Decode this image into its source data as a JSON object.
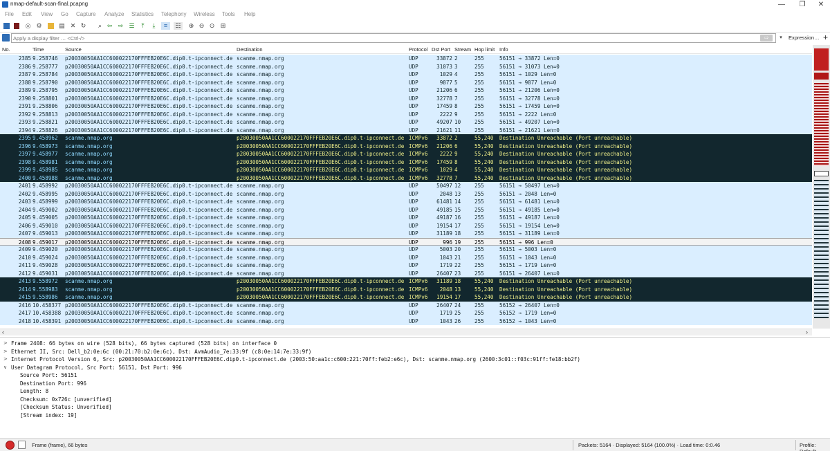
{
  "window": {
    "title": "nmap-default-scan-final.pcapng",
    "minimize": "—",
    "restore": "❐",
    "close": "✕"
  },
  "menu": [
    "File",
    "Edit",
    "View",
    "Go",
    "Capture",
    "Analyze",
    "Statistics",
    "Telephony",
    "Wireless",
    "Tools",
    "Help"
  ],
  "filter": {
    "placeholder": "Apply a display filter … <Ctrl-/>",
    "apply": "⇨",
    "dropdown": "▾",
    "expression": "Expression…",
    "add": "+"
  },
  "columns": [
    "No.",
    "Time",
    "Source",
    "Destination",
    "Protocol",
    "Dst Port",
    "Stream",
    "Hop limit",
    "Info"
  ],
  "packets": [
    {
      "no": "2385",
      "time": "9.258746",
      "src": "p20030050AA1CC600022170FFFEB20E6C.dip0.t-ipconnect.de",
      "dst": "scanme.nmap.org",
      "proto": "UDP",
      "port": "33872",
      "stream": "2",
      "hop": "255",
      "info": "56151 → 33872 Len=0",
      "kind": "udp"
    },
    {
      "no": "2386",
      "time": "9.258777",
      "src": "p20030050AA1CC600022170FFFEB20E6C.dip0.t-ipconnect.de",
      "dst": "scanme.nmap.org",
      "proto": "UDP",
      "port": "31073",
      "stream": "3",
      "hop": "255",
      "info": "56151 → 31073 Len=0",
      "kind": "udp"
    },
    {
      "no": "2387",
      "time": "9.258784",
      "src": "p20030050AA1CC600022170FFFEB20E6C.dip0.t-ipconnect.de",
      "dst": "scanme.nmap.org",
      "proto": "UDP",
      "port": "1029",
      "stream": "4",
      "hop": "255",
      "info": "56151 → 1029 Len=0",
      "kind": "udp"
    },
    {
      "no": "2388",
      "time": "9.258790",
      "src": "p20030050AA1CC600022170FFFEB20E6C.dip0.t-ipconnect.de",
      "dst": "scanme.nmap.org",
      "proto": "UDP",
      "port": "9877",
      "stream": "5",
      "hop": "255",
      "info": "56151 → 9877 Len=0",
      "kind": "udp"
    },
    {
      "no": "2389",
      "time": "9.258795",
      "src": "p20030050AA1CC600022170FFFEB20E6C.dip0.t-ipconnect.de",
      "dst": "scanme.nmap.org",
      "proto": "UDP",
      "port": "21206",
      "stream": "6",
      "hop": "255",
      "info": "56151 → 21206 Len=0",
      "kind": "udp"
    },
    {
      "no": "2390",
      "time": "9.258801",
      "src": "p20030050AA1CC600022170FFFEB20E6C.dip0.t-ipconnect.de",
      "dst": "scanme.nmap.org",
      "proto": "UDP",
      "port": "32778",
      "stream": "7",
      "hop": "255",
      "info": "56151 → 32778 Len=0",
      "kind": "udp"
    },
    {
      "no": "2391",
      "time": "9.258806",
      "src": "p20030050AA1CC600022170FFFEB20E6C.dip0.t-ipconnect.de",
      "dst": "scanme.nmap.org",
      "proto": "UDP",
      "port": "17459",
      "stream": "8",
      "hop": "255",
      "info": "56151 → 17459 Len=0",
      "kind": "udp"
    },
    {
      "no": "2392",
      "time": "9.258813",
      "src": "p20030050AA1CC600022170FFFEB20E6C.dip0.t-ipconnect.de",
      "dst": "scanme.nmap.org",
      "proto": "UDP",
      "port": "2222",
      "stream": "9",
      "hop": "255",
      "info": "56151 → 2222 Len=0",
      "kind": "udp"
    },
    {
      "no": "2393",
      "time": "9.258821",
      "src": "p20030050AA1CC600022170FFFEB20E6C.dip0.t-ipconnect.de",
      "dst": "scanme.nmap.org",
      "proto": "UDP",
      "port": "49207",
      "stream": "10",
      "hop": "255",
      "info": "56151 → 49207 Len=0",
      "kind": "udp"
    },
    {
      "no": "2394",
      "time": "9.258826",
      "src": "p20030050AA1CC600022170FFFEB20E6C.dip0.t-ipconnect.de",
      "dst": "scanme.nmap.org",
      "proto": "UDP",
      "port": "21621",
      "stream": "11",
      "hop": "255",
      "info": "56151 → 21621 Len=0",
      "kind": "udp"
    },
    {
      "no": "2395",
      "time": "9.458962",
      "src": "scanme.nmap.org",
      "dst": "p20030050AA1CC600022170FFFEB20E6C.dip0.t-ipconnect.de",
      "proto": "ICMPv6",
      "port": "33872",
      "stream": "2",
      "hop": "55,240",
      "info": "Destination Unreachable (Port unreachable)",
      "kind": "icmp"
    },
    {
      "no": "2396",
      "time": "9.458973",
      "src": "scanme.nmap.org",
      "dst": "p20030050AA1CC600022170FFFEB20E6C.dip0.t-ipconnect.de",
      "proto": "ICMPv6",
      "port": "21206",
      "stream": "6",
      "hop": "55,240",
      "info": "Destination Unreachable (Port unreachable)",
      "kind": "icmp"
    },
    {
      "no": "2397",
      "time": "9.458977",
      "src": "scanme.nmap.org",
      "dst": "p20030050AA1CC600022170FFFEB20E6C.dip0.t-ipconnect.de",
      "proto": "ICMPv6",
      "port": "2222",
      "stream": "9",
      "hop": "55,240",
      "info": "Destination Unreachable (Port unreachable)",
      "kind": "icmp"
    },
    {
      "no": "2398",
      "time": "9.458981",
      "src": "scanme.nmap.org",
      "dst": "p20030050AA1CC600022170FFFEB20E6C.dip0.t-ipconnect.de",
      "proto": "ICMPv6",
      "port": "17459",
      "stream": "8",
      "hop": "55,240",
      "info": "Destination Unreachable (Port unreachable)",
      "kind": "icmp"
    },
    {
      "no": "2399",
      "time": "9.458985",
      "src": "scanme.nmap.org",
      "dst": "p20030050AA1CC600022170FFFEB20E6C.dip0.t-ipconnect.de",
      "proto": "ICMPv6",
      "port": "1029",
      "stream": "4",
      "hop": "55,240",
      "info": "Destination Unreachable (Port unreachable)",
      "kind": "icmp"
    },
    {
      "no": "2400",
      "time": "9.458988",
      "src": "scanme.nmap.org",
      "dst": "p20030050AA1CC600022170FFFEB20E6C.dip0.t-ipconnect.de",
      "proto": "ICMPv6",
      "port": "32778",
      "stream": "7",
      "hop": "55,240",
      "info": "Destination Unreachable (Port unreachable)",
      "kind": "icmp"
    },
    {
      "no": "2401",
      "time": "9.458992",
      "src": "p20030050AA1CC600022170FFFEB20E6C.dip0.t-ipconnect.de",
      "dst": "scanme.nmap.org",
      "proto": "UDP",
      "port": "50497",
      "stream": "12",
      "hop": "255",
      "info": "56151 → 50497 Len=0",
      "kind": "udp"
    },
    {
      "no": "2402",
      "time": "9.458995",
      "src": "p20030050AA1CC600022170FFFEB20E6C.dip0.t-ipconnect.de",
      "dst": "scanme.nmap.org",
      "proto": "UDP",
      "port": "2048",
      "stream": "13",
      "hop": "255",
      "info": "56151 → 2048 Len=0",
      "kind": "udp"
    },
    {
      "no": "2403",
      "time": "9.458999",
      "src": "p20030050AA1CC600022170FFFEB20E6C.dip0.t-ipconnect.de",
      "dst": "scanme.nmap.org",
      "proto": "UDP",
      "port": "61481",
      "stream": "14",
      "hop": "255",
      "info": "56151 → 61481 Len=0",
      "kind": "udp"
    },
    {
      "no": "2404",
      "time": "9.459002",
      "src": "p20030050AA1CC600022170FFFEB20E6C.dip0.t-ipconnect.de",
      "dst": "scanme.nmap.org",
      "proto": "UDP",
      "port": "49185",
      "stream": "15",
      "hop": "255",
      "info": "56151 → 49185 Len=0",
      "kind": "udp"
    },
    {
      "no": "2405",
      "time": "9.459005",
      "src": "p20030050AA1CC600022170FFFEB20E6C.dip0.t-ipconnect.de",
      "dst": "scanme.nmap.org",
      "proto": "UDP",
      "port": "49187",
      "stream": "16",
      "hop": "255",
      "info": "56151 → 49187 Len=0",
      "kind": "udp"
    },
    {
      "no": "2406",
      "time": "9.459010",
      "src": "p20030050AA1CC600022170FFFEB20E6C.dip0.t-ipconnect.de",
      "dst": "scanme.nmap.org",
      "proto": "UDP",
      "port": "19154",
      "stream": "17",
      "hop": "255",
      "info": "56151 → 19154 Len=0",
      "kind": "udp"
    },
    {
      "no": "2407",
      "time": "9.459013",
      "src": "p20030050AA1CC600022170FFFEB20E6C.dip0.t-ipconnect.de",
      "dst": "scanme.nmap.org",
      "proto": "UDP",
      "port": "31189",
      "stream": "18",
      "hop": "255",
      "info": "56151 → 31189 Len=0",
      "kind": "udp"
    },
    {
      "no": "2408",
      "time": "9.459017",
      "src": "p20030050AA1CC600022170FFFEB20E6C.dip0.t-ipconnect.de",
      "dst": "scanme.nmap.org",
      "proto": "UDP",
      "port": "996",
      "stream": "19",
      "hop": "255",
      "info": "56151 → 996 Len=0",
      "kind": "sel"
    },
    {
      "no": "2409",
      "time": "9.459020",
      "src": "p20030050AA1CC600022170FFFEB20E6C.dip0.t-ipconnect.de",
      "dst": "scanme.nmap.org",
      "proto": "UDP",
      "port": "5003",
      "stream": "20",
      "hop": "255",
      "info": "56151 → 5003 Len=0",
      "kind": "udp"
    },
    {
      "no": "2410",
      "time": "9.459024",
      "src": "p20030050AA1CC600022170FFFEB20E6C.dip0.t-ipconnect.de",
      "dst": "scanme.nmap.org",
      "proto": "UDP",
      "port": "1043",
      "stream": "21",
      "hop": "255",
      "info": "56151 → 1043 Len=0",
      "kind": "udp"
    },
    {
      "no": "2411",
      "time": "9.459028",
      "src": "p20030050AA1CC600022170FFFEB20E6C.dip0.t-ipconnect.de",
      "dst": "scanme.nmap.org",
      "proto": "UDP",
      "port": "1719",
      "stream": "22",
      "hop": "255",
      "info": "56151 → 1719 Len=0",
      "kind": "udp"
    },
    {
      "no": "2412",
      "time": "9.459031",
      "src": "p20030050AA1CC600022170FFFEB20E6C.dip0.t-ipconnect.de",
      "dst": "scanme.nmap.org",
      "proto": "UDP",
      "port": "26407",
      "stream": "23",
      "hop": "255",
      "info": "56151 → 26407 Len=0",
      "kind": "udp"
    },
    {
      "no": "2413",
      "time": "9.558972",
      "src": "scanme.nmap.org",
      "dst": "p20030050AA1CC600022170FFFEB20E6C.dip0.t-ipconnect.de",
      "proto": "ICMPv6",
      "port": "31189",
      "stream": "18",
      "hop": "55,240",
      "info": "Destination Unreachable (Port unreachable)",
      "kind": "icmp"
    },
    {
      "no": "2414",
      "time": "9.558983",
      "src": "scanme.nmap.org",
      "dst": "p20030050AA1CC600022170FFFEB20E6C.dip0.t-ipconnect.de",
      "proto": "ICMPv6",
      "port": "2048",
      "stream": "13",
      "hop": "55,240",
      "info": "Destination Unreachable (Port unreachable)",
      "kind": "icmp"
    },
    {
      "no": "2415",
      "time": "9.558986",
      "src": "scanme.nmap.org",
      "dst": "p20030050AA1CC600022170FFFEB20E6C.dip0.t-ipconnect.de",
      "proto": "ICMPv6",
      "port": "19154",
      "stream": "17",
      "hop": "55,240",
      "info": "Destination Unreachable (Port unreachable)",
      "kind": "icmp"
    },
    {
      "no": "2416",
      "time": "10.458377",
      "src": "p20030050AA1CC600022170FFFEB20E6C.dip0.t-ipconnect.de",
      "dst": "scanme.nmap.org",
      "proto": "UDP",
      "port": "26407",
      "stream": "24",
      "hop": "255",
      "info": "56152 → 26407 Len=0",
      "kind": "udp"
    },
    {
      "no": "2417",
      "time": "10.458388",
      "src": "p20030050AA1CC600022170FFFEB20E6C.dip0.t-ipconnect.de",
      "dst": "scanme.nmap.org",
      "proto": "UDP",
      "port": "1719",
      "stream": "25",
      "hop": "255",
      "info": "56152 → 1719 Len=0",
      "kind": "udp"
    },
    {
      "no": "2418",
      "time": "10.458391",
      "src": "p20030050AA1CC600022170FFFEB20E6C.dip0.t-ipconnect.de",
      "dst": "scanme.nmap.org",
      "proto": "UDP",
      "port": "1043",
      "stream": "26",
      "hop": "255",
      "info": "56152 → 1043 Len=0",
      "kind": "udp"
    }
  ],
  "details": [
    {
      "arrow": ">",
      "text": "Frame 2408: 66 bytes on wire (528 bits), 66 bytes captured (528 bits) on interface 0",
      "indent": 0
    },
    {
      "arrow": ">",
      "text": "Ethernet II, Src: Dell_b2:0e:6c (00:21:70:b2:0e:6c), Dst: AvmAudio_7e:33:9f (c8:0e:14:7e:33:9f)",
      "indent": 0
    },
    {
      "arrow": ">",
      "text": "Internet Protocol Version 6, Src: p20030050AA1CC600022170FFFEB20E6C.dip0.t-ipconnect.de (2003:50:aa1c:c600:221:70ff:feb2:e6c), Dst: scanme.nmap.org (2600:3c01::f03c:91ff:fe18:bb2f)",
      "indent": 0
    },
    {
      "arrow": "∨",
      "text": "User Datagram Protocol, Src Port: 56151, Dst Port: 996",
      "indent": 0
    },
    {
      "arrow": "",
      "text": "Source Port: 56151",
      "indent": 1
    },
    {
      "arrow": "",
      "text": "Destination Port: 996",
      "indent": 1
    },
    {
      "arrow": "",
      "text": "Length: 8",
      "indent": 1
    },
    {
      "arrow": "",
      "text": "Checksum: 0x726c [unverified]",
      "indent": 1
    },
    {
      "arrow": "",
      "text": "[Checksum Status: Unverified]",
      "indent": 1
    },
    {
      "arrow": "",
      "text": "[Stream index: 19]",
      "indent": 1
    }
  ],
  "status": {
    "frame": "Frame (frame), 66 bytes",
    "packets": "Packets: 5164 · Displayed: 5164 (100.0%) · Load time: 0:0.46",
    "profile": "Profile: Default"
  },
  "colors": {
    "udp_bg": "#daeeff",
    "icmp_bg": "#12272e",
    "icmp_fg": "#f0f08a",
    "accent": "#1e63b8"
  }
}
